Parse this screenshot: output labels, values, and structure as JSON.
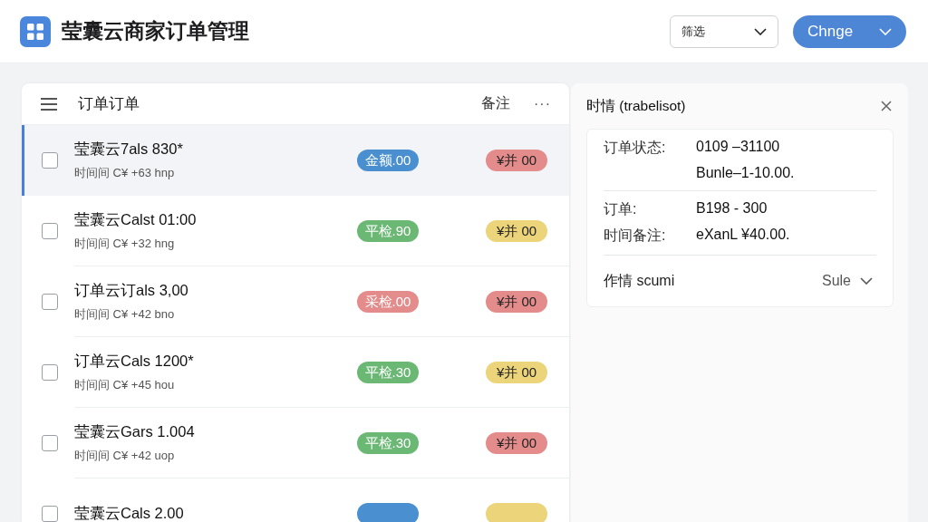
{
  "header": {
    "title": "莹囊云商家订单管理",
    "filter": {
      "label": "筛选"
    },
    "action": {
      "label": "Chnge"
    }
  },
  "list": {
    "title": "订单订单",
    "note": "备注",
    "more": "···",
    "rows": [
      {
        "title": "莹囊云7als 830*",
        "subtitle": "时间间 C¥ +63 hnp",
        "selected": true,
        "checked": false,
        "badges": [
          {
            "text": "金额.00",
            "color": "#4a8fd0"
          },
          {
            "text": "¥并 00",
            "color": "#e48c8c"
          }
        ]
      },
      {
        "title": "莹囊云Calst 01:00",
        "subtitle": "时间间 C¥ +32 hng",
        "selected": false,
        "checked": false,
        "badges": [
          {
            "text": "平检.90",
            "color": "#6bb874"
          },
          {
            "text": "¥并 00",
            "color": "#ecd47a"
          }
        ]
      },
      {
        "title": "订单云订als 3,00",
        "subtitle": "时间间 C¥ +42 bno",
        "selected": false,
        "checked": false,
        "badges": [
          {
            "text": "采检.00",
            "color": "#e48c8c"
          },
          {
            "text": "¥并 00",
            "color": "#e48c8c"
          }
        ]
      },
      {
        "title": "订单云Cals 1200*",
        "subtitle": "时间间 C¥ +45 hou",
        "selected": false,
        "checked": false,
        "badges": [
          {
            "text": "平检.30",
            "color": "#6bb874"
          },
          {
            "text": "¥并 00",
            "color": "#ecd47a"
          }
        ]
      },
      {
        "title": "莹囊云Gars 1.004",
        "subtitle": "时间间 C¥ +42 uop",
        "selected": false,
        "checked": false,
        "badges": [
          {
            "text": "平检.30",
            "color": "#6bb874"
          },
          {
            "text": "¥并 00",
            "color": "#e48c8c"
          }
        ]
      },
      {
        "title": "莹囊云Cals 2.00",
        "selected": false,
        "checked": false,
        "badges": [
          {
            "color": "#4a8fd0"
          },
          {
            "color": "#ecd47a"
          }
        ]
      }
    ]
  },
  "detail": {
    "title": "时情 (trabelisot)",
    "sections": [
      {
        "fields": [
          {
            "label": "订单状态:",
            "values": [
              "0109 –31100",
              "Bunle–1-10.00."
            ]
          }
        ]
      },
      {
        "fields": [
          {
            "label": "订单:",
            "values": [
              "B198 - 300"
            ]
          },
          {
            "label": "时间备注:",
            "values": [
              "eXanL ¥40.00."
            ]
          }
        ]
      }
    ],
    "footer": {
      "label": "作情 scumi",
      "value": "Sule"
    }
  }
}
